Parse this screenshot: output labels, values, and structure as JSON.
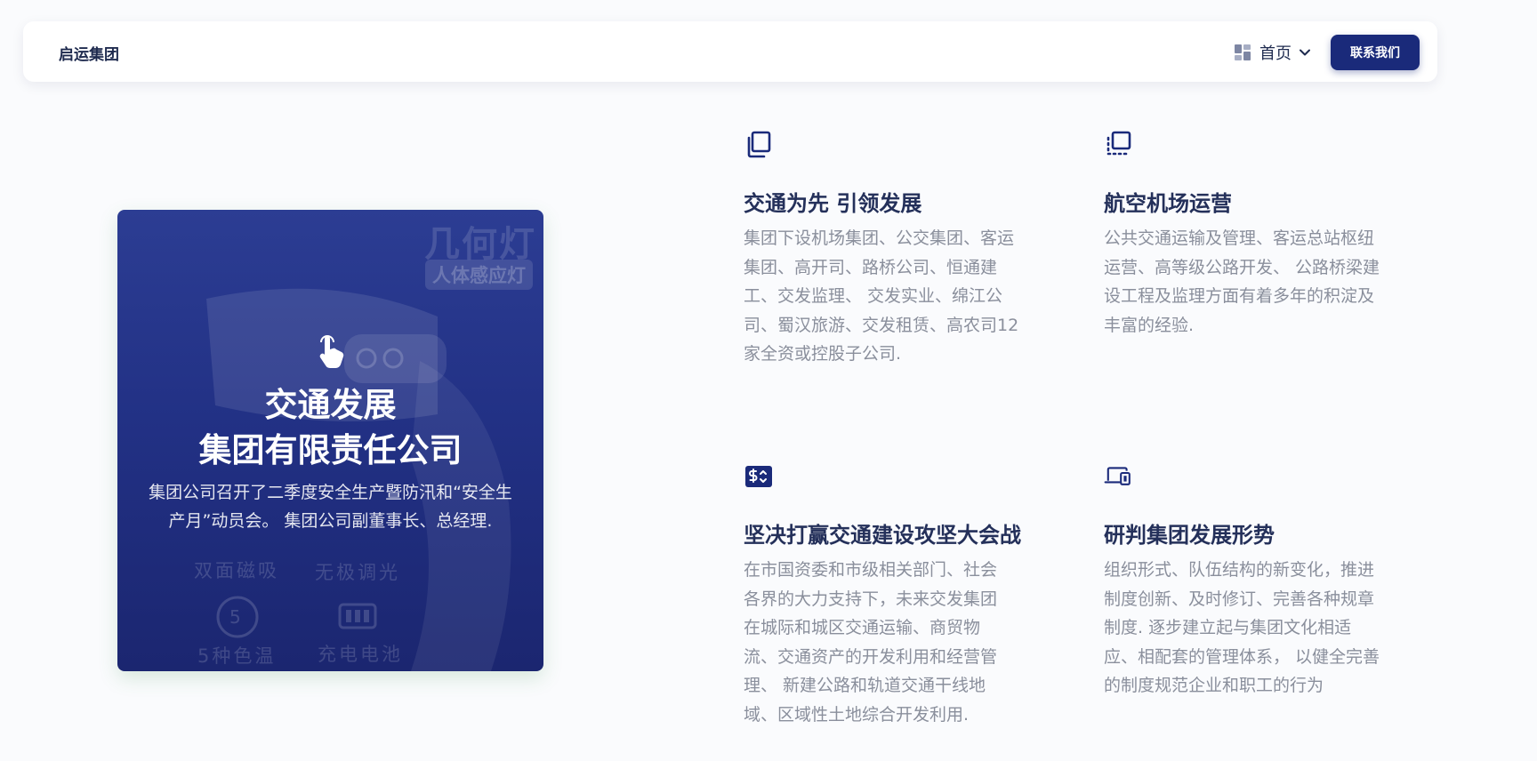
{
  "nav": {
    "brand": "启运集团",
    "home_label": "首页",
    "contact_label": "联系我们"
  },
  "hero": {
    "title_line1": "交通发展",
    "title_line2": "集团有限责任公司",
    "description": "集团公司召开了二季度安全生产暨防汛和“安全生产月”动员会。 集团公司副董事长、总经理.",
    "background_texts": {
      "product_name": "几何灯",
      "product_badge": "人体感应灯",
      "feature_1": "双面磁吸",
      "feature_2": "无极调光",
      "feature_3": "5种色温",
      "feature_4": "充电电池",
      "dial_number": "5"
    }
  },
  "features": [
    {
      "icon": "copy-icon",
      "title": "交通为先 引领发展",
      "description": "集团下设机场集团、公交集团、客运集团、高开司、路桥公司、恒通建工、交发监理、 交发实业、绵江公司、蜀汉旅游、交发租赁、高农司12家全资或控股子公司."
    },
    {
      "icon": "layers-icon",
      "title": "航空机场运营",
      "description": "公共交通运输及管理、客运总站枢纽运营、高等级公路开发、 公路桥梁建设工程及监理方面有着多年的积淀及丰富的经验."
    },
    {
      "icon": "money-icon",
      "title": "坚决打赢交通建设攻坚大会战",
      "description": "在市国资委和市级相关部门、社会各界的大力支持下，未来交发集团在城际和城区交通运输、商贸物流、交通资产的开发利用和经营管理、 新建公路和轨道交通干线地域、区域性土地综合开发利用."
    },
    {
      "icon": "devices-icon",
      "title": "研判集团发展形势",
      "description": "组织形式、队伍结构的新变化，推进制度创新、及时修订、完善各种规章制度. 逐步建立起与集团文化相适应、相配套的管理体系， 以健全完善的制度规范企业和职工的行为"
    }
  ],
  "colors": {
    "accent": "#1a2a7a",
    "card_top": "#2c3d93",
    "card_bottom": "#1b2670",
    "heading": "#24305a",
    "body_text": "#8a8f9c",
    "page_bg": "#fafbfd"
  }
}
